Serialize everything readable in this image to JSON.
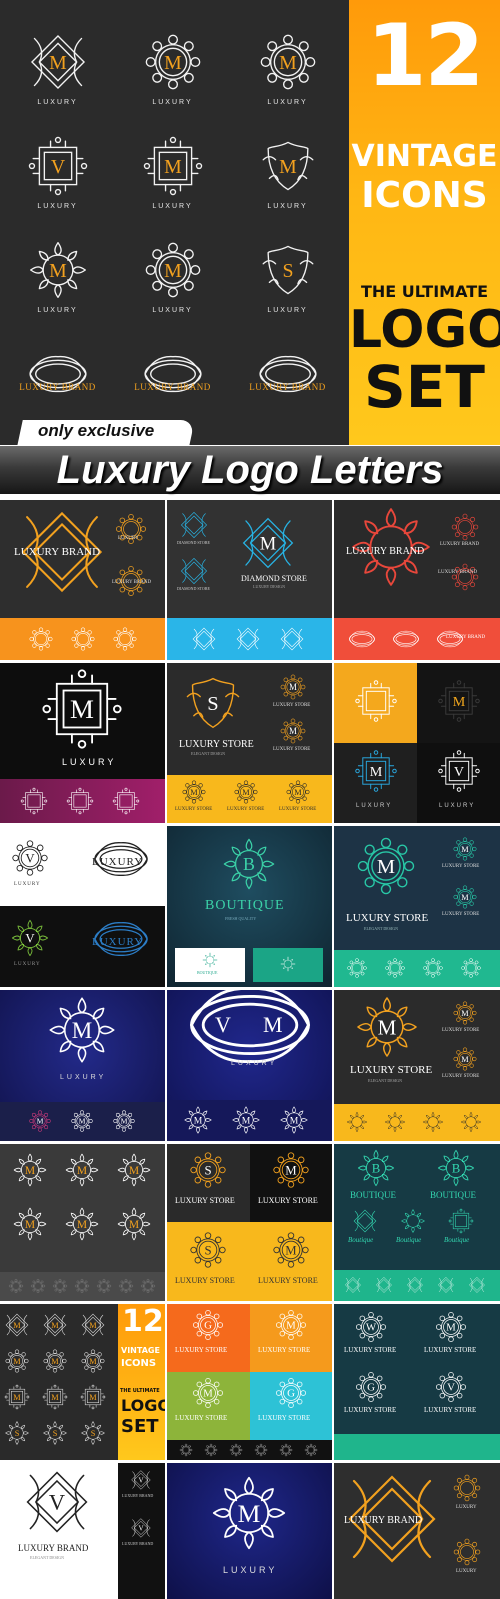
{
  "hero": {
    "cells": [
      {
        "caption": "LUXURY",
        "letter": "M"
      },
      {
        "caption": "LUXURY",
        "letter": "M"
      },
      {
        "caption": "LUXURY",
        "letter": "M"
      },
      {
        "caption": "LUXURY",
        "letter": "V"
      },
      {
        "caption": "LUXURY",
        "letter": "M"
      },
      {
        "caption": "LUXURY",
        "letter": "M"
      },
      {
        "caption": "LUXURY",
        "letter": "M"
      },
      {
        "caption": "LUXURY",
        "letter": "M"
      },
      {
        "caption": "LUXURY",
        "letter": "S"
      },
      {
        "caption": "LUXURY BRAND",
        "letter": ""
      },
      {
        "caption": "LUXURY BRAND",
        "letter": ""
      },
      {
        "caption": "LUXURY BRAND",
        "letter": ""
      }
    ],
    "panel": {
      "number": "12",
      "line1": "VINTAGE",
      "line2": "ICONS",
      "line3": "THE ULTIMATE",
      "line4": "LOGO",
      "line5": "SET"
    },
    "badge": "only exclusive"
  },
  "title": "Luxury Logo Letters",
  "thumbnails": {
    "t1": {
      "label": "LUXURY BRAND",
      "small1": "LUXURY",
      "small2": "LUXURY BRAND"
    },
    "t2": {
      "label": "DIAMOND STORE",
      "letter": "M",
      "small1": "DIAMOND STORE",
      "small2": "DIAMOND STORE",
      "sub": "LUXURY DESIGN"
    },
    "t3": {
      "label": "LUXURY BRAND",
      "small1": "LUXURY BRAND",
      "small2": "LUXURY BRAND",
      "mini": "LUXURY BRAND"
    },
    "t4": {
      "label": "LUXURY",
      "letter": "M"
    },
    "t5": {
      "label": "LUXURY STORE",
      "letter": "S",
      "sub": "ELEGANT DESIGN",
      "small1": "LUXURY STORE",
      "small2": "LUXURY STORE",
      "mini1": "LUXURY STORE",
      "mini2": "LUXURY STORE",
      "mini3": "LUXURY STORE"
    },
    "t6": {
      "letter1": "V",
      "letter2": "M",
      "letter3": "M",
      "letter4": "V",
      "cap1": "LUXURY",
      "cap2": "LUXURY"
    },
    "t7": {
      "letter": "V",
      "cap": "LUXURY",
      "word": "LUXURY",
      "letter2": "V",
      "cap2": "LUXURY",
      "word2": "LUXURY"
    },
    "t8": {
      "label": "BOUTIQUE",
      "letter": "B",
      "sub": "FRESH QUALITY",
      "small1": "BOUTIQUE"
    },
    "t9": {
      "label": "LUXURY STORE",
      "letter": "M",
      "sub": "ELEGANT DESIGN",
      "small1": "LUXURY STORE",
      "small2": "LUXURY STORE"
    },
    "t10": {
      "label": "LUXURY",
      "letter": "M"
    },
    "t11": {
      "label": "LUXURY",
      "letter1": "V",
      "letter2": "M"
    },
    "t12": {
      "label": "LUXURY STORE",
      "letter": "M",
      "sub": "ELEGANT DESIGN",
      "small1": "LUXURY STORE",
      "small2": "LUXURY STORE"
    },
    "t13": {
      "letter": "M"
    },
    "t14": {
      "label1": "LUXURY STORE",
      "label2": "LUXURY STORE",
      "label3": "LUXURY STORE",
      "label4": "LUXURY STORE",
      "letter1": "S",
      "letter2": "M",
      "letter3": "S",
      "letter4": "M"
    },
    "t15": {
      "label1": "BOUTIQUE",
      "label2": "BOUTIQUE",
      "mini1": "Boutique",
      "mini2": "Boutique",
      "mini3": "Boutique",
      "letter": "B"
    },
    "t16": {
      "number": "12",
      "line1": "VINTAGE",
      "line2": "ICONS",
      "line3": "THE ULTIMATE",
      "line4": "LOGO",
      "line5": "SET"
    },
    "t17": {
      "label1": "LUXURY STORE",
      "label2": "LUXURY STORE",
      "label3": "LUXURY STORE",
      "label4": "LUXURY STORE",
      "letter1": "G",
      "letter2": "M",
      "letter3": "M",
      "letter4": "G"
    },
    "t18": {
      "label1": "LUXURY STORE",
      "label2": "LUXURY STORE",
      "label3": "LUXURY STORE",
      "label4": "LUXURY STORE",
      "letter1": "W",
      "letter2": "M",
      "letter3": "G",
      "letter4": "V"
    },
    "t19": {
      "label": "LUXURY BRAND",
      "sub": "ELEGANT DESIGN",
      "letter": "V",
      "small1": "LUXURY BRAND",
      "small2": "LUXURY BRAND"
    },
    "t20": {
      "label": "LUXURY",
      "letter": "M"
    },
    "t21": {
      "label": "LUXURY BRAND",
      "small1": "LUXURY",
      "small2": "LUXURY"
    }
  }
}
